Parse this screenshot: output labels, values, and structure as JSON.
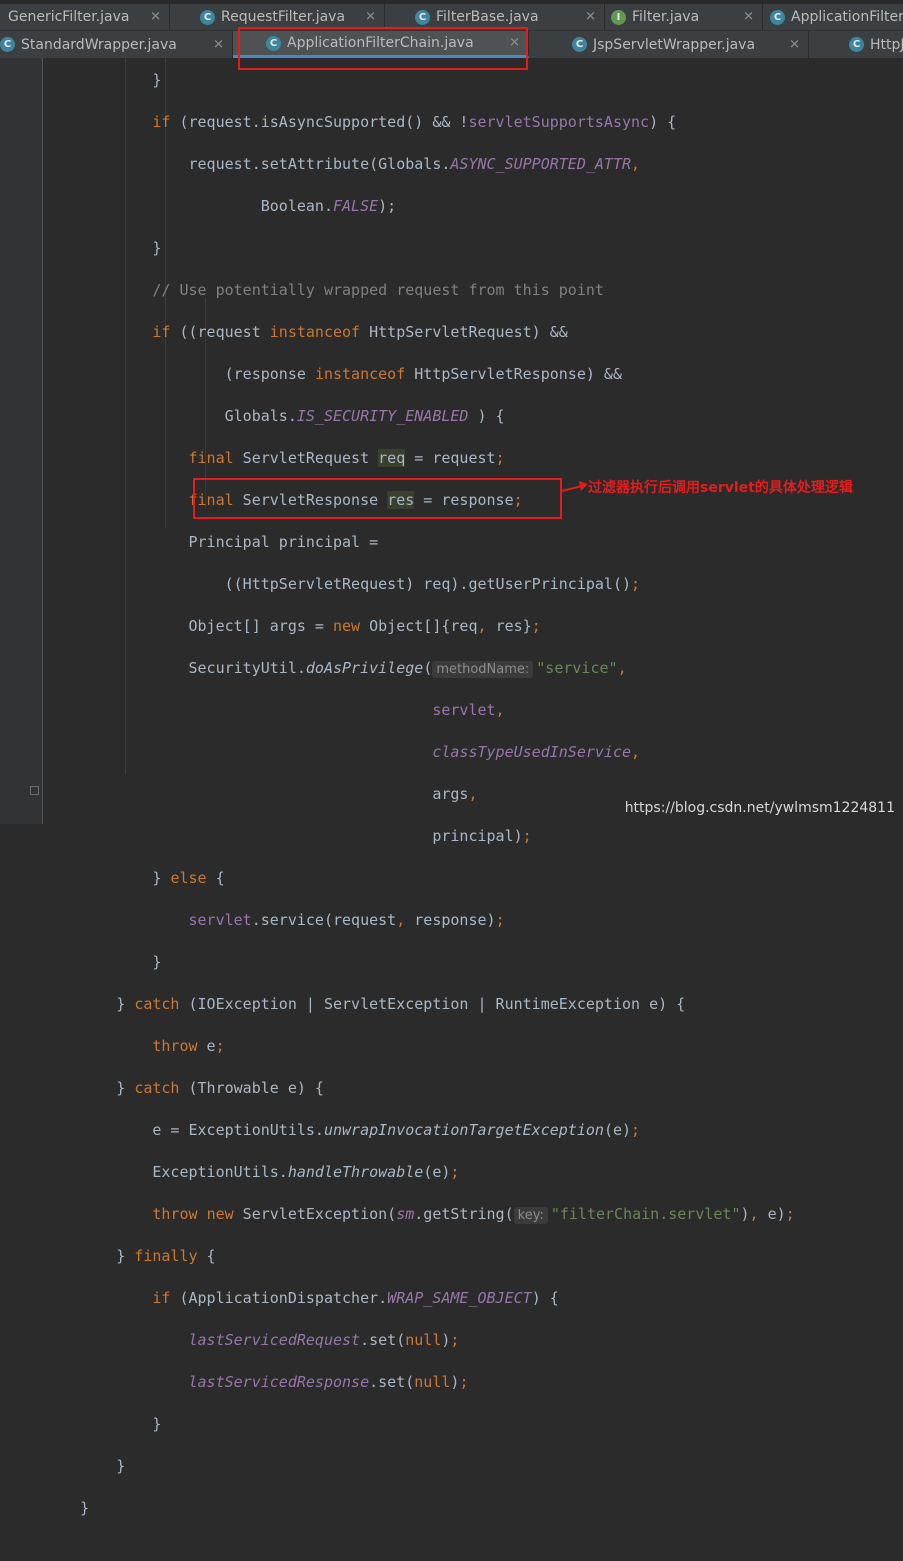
{
  "tabs_row1": [
    {
      "label": "GenericFilter.java",
      "icon": "class-icon"
    },
    {
      "label": "RequestFilter.java",
      "icon": "class-icon"
    },
    {
      "label": "FilterBase.java",
      "icon": "class-icon"
    },
    {
      "label": "Filter.java",
      "icon": "interface-icon"
    },
    {
      "label": "ApplicationFilter",
      "icon": "class-icon"
    }
  ],
  "tabs_row2": [
    {
      "label": "StandardWrapper.java",
      "icon": "class-icon"
    },
    {
      "label": "ApplicationFilterChain.java",
      "icon": "class-icon",
      "active": true
    },
    {
      "label": "JspServletWrapper.java",
      "icon": "class-icon"
    },
    {
      "label": "HttpJ",
      "icon": "class-icon"
    }
  ],
  "code": {
    "l0": "            }",
    "l1_if": "if",
    "l1_a": " (request.isAsyncSupported() && !",
    "l1_f": "servletSupportsAsync",
    "l1_b": ") {",
    "l2_a": "request.setAttribute(Globals.",
    "l2_f": "ASYNC_SUPPORTED_ATTR",
    "l2_b": ",",
    "l3_a": "Boolean.",
    "l3_f": "FALSE",
    "l3_b": ");",
    "l4": "}",
    "l5": "// Use potentially wrapped request from this point",
    "l6_if": "if",
    "l6_a": " ((request ",
    "l6_kw": "instanceof",
    "l6_b": " HttpServletRequest) &&",
    "l7_a": "(response ",
    "l7_kw": "instanceof",
    "l7_b": " HttpServletResponse) &&",
    "l8_a": "Globals.",
    "l8_f": "IS_SECURITY_ENABLED",
    "l8_b": " ) {",
    "l9_kw": "final",
    "l9_a": " ServletRequest ",
    "l9_v": "req",
    "l9_b": " = request",
    "l10_kw": "final",
    "l10_a": " ServletResponse ",
    "l10_v": "res",
    "l10_b": " = response",
    "l11": "Principal principal =",
    "l12_a": "((HttpServletRequest) req).getUserPrincipal()",
    "l13_a": "Object[] args = ",
    "l13_kw": "new",
    "l13_b": " Object[]{req",
    ", ": ", ",
    "l13_c": "res}",
    "l14_a": "SecurityUtil.",
    "l14_m": "doAsPrivilege",
    "l14_b": "(",
    "l14_hint": "methodName:",
    "l14_s": "\"service\"",
    "l15_f": "servlet",
    "l16_f": "classTypeUsedInService",
    "l17_a": "args",
    "l18_a": "principal)",
    "l19_a": "} ",
    "l19_kw": "else",
    "l19_b": " {",
    "l20_f": "servlet",
    "l20_a": ".service(request",
    ", 2": ", ",
    "l20_b": "response)",
    "l21": "}",
    "l22_a": "} ",
    "l22_kw": "catch",
    "l22_b": " (IOException | ServletException | RuntimeException e) {",
    "l23_kw": "throw",
    "l23_a": " e",
    "l24_a": "} ",
    "l24_kw": "catch",
    "l24_b": " (Throwable e) {",
    "l25_a": "e = ExceptionUtils.",
    "l25_m": "unwrapInvocationTargetException",
    "l25_b": "(e)",
    "l26_a": "ExceptionUtils.",
    "l26_m": "handleThrowable",
    "l26_b": "(e)",
    "l27_kw": "throw",
    "l27_sp": " ",
    "l27_kw2": "new",
    "l27_a": " ServletException(",
    "l27_f": "sm",
    "l27_b": ".getString(",
    "l27_hint": "key:",
    "l27_s": "\"filterChain.servlet\"",
    "l27_c": ")",
    "l27_d": " e)",
    "l28_a": "} ",
    "l28_kw": "finally",
    "l28_b": " {",
    "l29_kw": "if",
    "l29_a": " (ApplicationDispatcher.",
    "l29_f": "WRAP_SAME_OBJECT",
    "l29_b": ") {",
    "l30_f": "lastServicedRequest",
    "l30_a": ".set(",
    "l30_kw": "null",
    "l30_b": ")",
    "l31_f": "lastServicedResponse",
    "l31_a": ".set(",
    "l31_kw": "null",
    "l31_b": ")",
    "l32": "}",
    "l33": "}",
    "l34": "}"
  },
  "annotation": "过滤器执行后调用servlet的具体处理逻辑",
  "watermark": "https://blog.csdn.net/ywlmsm1224811",
  "colors": {
    "keyword": "#cc7832",
    "field": "#9876aa",
    "string": "#6a8759",
    "comment": "#808080",
    "annotation": "#e41c1c"
  }
}
